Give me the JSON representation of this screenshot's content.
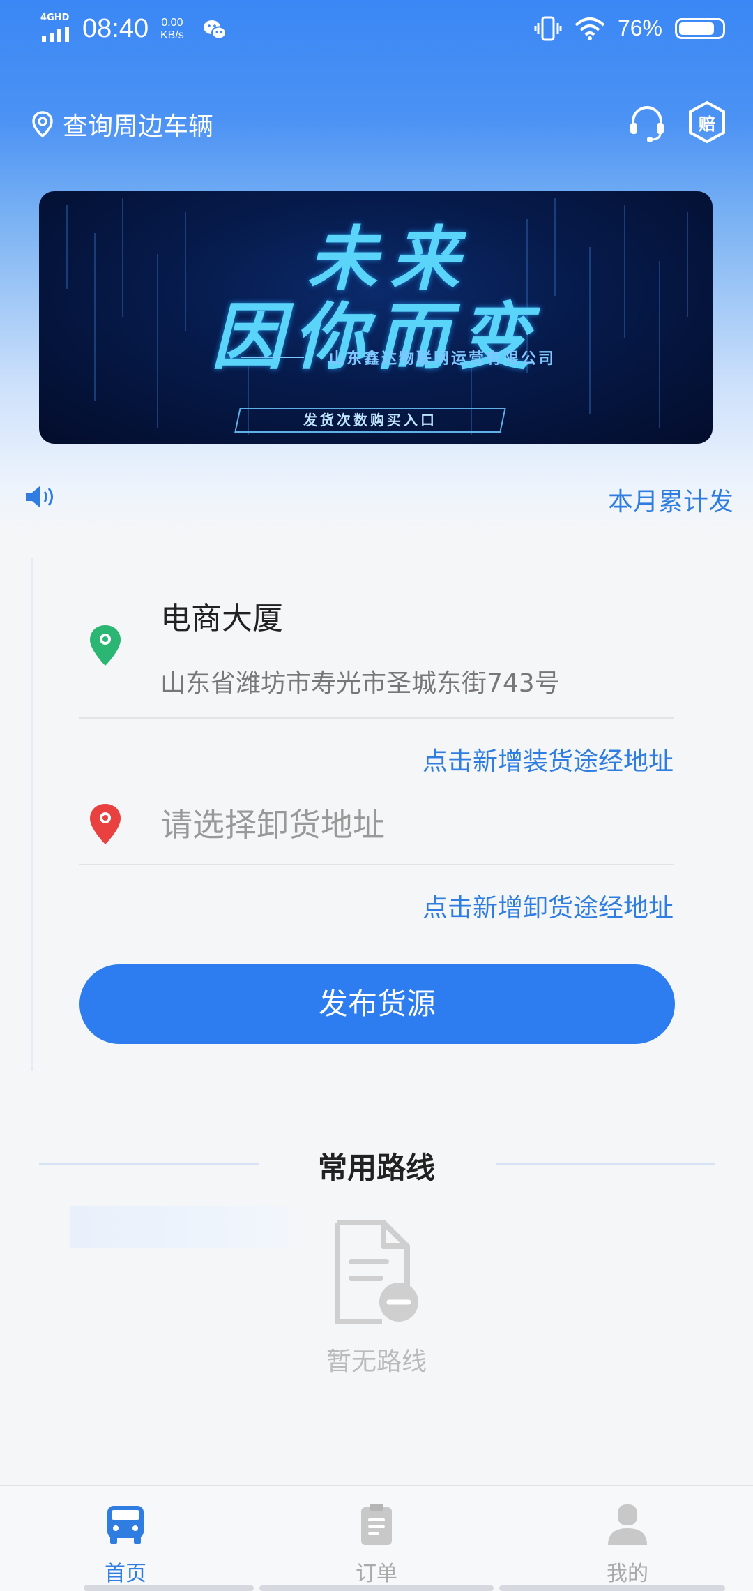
{
  "status_bar": {
    "network": "4GHD",
    "time": "08:40",
    "speed_value": "0.00",
    "speed_unit": "KB/s",
    "battery_text": "76%",
    "battery_level": 0.76
  },
  "header": {
    "location_link": "查询周边车辆",
    "badge_text": "赔"
  },
  "banner": {
    "title_line1": "未来",
    "title_line2": "因你而变",
    "company": "山东鑫达物联网运营有限公司",
    "entry_button": "发货次数购买入口"
  },
  "notice": {
    "text": "本月累计发"
  },
  "form": {
    "load_name": "电商大厦",
    "load_address": "山东省潍坊市寿光市圣城东街743号",
    "add_load_waypoint": "点击新增装货途经地址",
    "unload_placeholder": "请选择卸货地址",
    "add_unload_waypoint": "点击新增卸货途经地址",
    "publish_button": "发布货源"
  },
  "routes": {
    "title": "常用路线",
    "empty_text": "暂无路线"
  },
  "bottom_nav": {
    "items": [
      {
        "label": "首页",
        "icon": "truck-icon",
        "active": true
      },
      {
        "label": "订单",
        "icon": "clipboard-icon",
        "active": false
      },
      {
        "label": "我的",
        "icon": "user-icon",
        "active": false
      }
    ]
  },
  "colors": {
    "accent": "#2d7cf0",
    "link": "#2f7de1",
    "load_pin": "#2bb673",
    "unload_pin": "#e94040"
  }
}
